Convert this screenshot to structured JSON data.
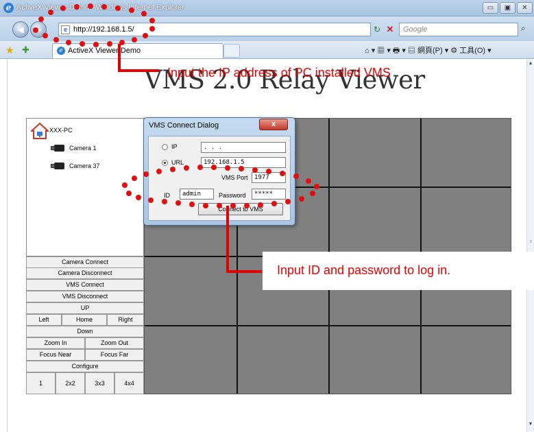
{
  "window": {
    "title": "ActiveX Viewer Demo - Windows Internet Explorer",
    "minimize": "▭",
    "maximize": "▣",
    "close": "✕"
  },
  "address": {
    "url": "http://192.168.1.5/",
    "search_placeholder": "Google"
  },
  "tab": {
    "label": "ActiveX Viewer Demo"
  },
  "command_bar": {
    "text": "⌂ ▾  ▦ ▾  🖶 ▾  ▤ 網頁(P) ▾  ⚙ 工具(O) ▾"
  },
  "page": {
    "title": "VMS 2.0 Relay Viewer"
  },
  "tree": {
    "root": "XXX-PC",
    "cameras": [
      "Camera 1",
      "Camera 37"
    ]
  },
  "panel": {
    "camera_connect": "Camera Connect",
    "camera_disconnect": "Camera Disconnect",
    "vms_connect": "VMS Connect",
    "vms_disconnect": "VMS Disconnect",
    "up": "UP",
    "left": "Left",
    "home": "Home",
    "right": "Right",
    "down": "Down",
    "zoom_in": "Zoom In",
    "zoom_out": "Zoom Out",
    "focus_near": "Focus Near",
    "focus_far": "Focus Far",
    "configure": "Configure",
    "layouts": [
      "1",
      "2x2",
      "3x3",
      "4x4"
    ]
  },
  "dialog": {
    "title": "VMS Connect Dialog",
    "close": "x",
    "ip_label": "IP",
    "ip_value": ".      .      .",
    "url_label": "URL",
    "url_value": "192.168.1.5",
    "port_label": "VMS Port",
    "port_value": "1977",
    "id_label": "ID",
    "id_value": "admin",
    "password_label": "Password",
    "password_value": "*****",
    "connect_button": "Connect to VMS",
    "selected_mode": "URL"
  },
  "annotations": {
    "ip_note": "Input the IP address of PC installed VMS",
    "login_note": "Input ID and password to log in."
  },
  "colors": {
    "annotation": "#e60000",
    "grid_bg": "#808080",
    "grid_lines": "#111111"
  }
}
